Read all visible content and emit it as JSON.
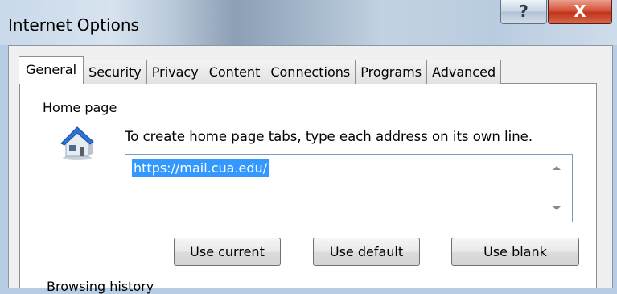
{
  "window": {
    "title": "Internet Options",
    "help_label": "?",
    "close_label": "X"
  },
  "tabs": [
    {
      "label": "General",
      "active": true
    },
    {
      "label": "Security",
      "active": false
    },
    {
      "label": "Privacy",
      "active": false
    },
    {
      "label": "Content",
      "active": false
    },
    {
      "label": "Connections",
      "active": false
    },
    {
      "label": "Programs",
      "active": false
    },
    {
      "label": "Advanced",
      "active": false
    }
  ],
  "home_page": {
    "group_label": "Home page",
    "hint": "To create home page tabs, type each address on its own line.",
    "address": "https://mail.cua.edu/",
    "buttons": {
      "use_current": "Use current",
      "use_default": "Use default",
      "use_blank": "Use blank"
    }
  },
  "browsing_history": {
    "group_label": "Browsing history"
  },
  "icons": {
    "home": "house-icon",
    "help": "question-icon",
    "close": "close-icon"
  },
  "colors": {
    "selection": "#3399ff",
    "close_button": "#c7402a",
    "tab_border": "#8e8f8f"
  }
}
